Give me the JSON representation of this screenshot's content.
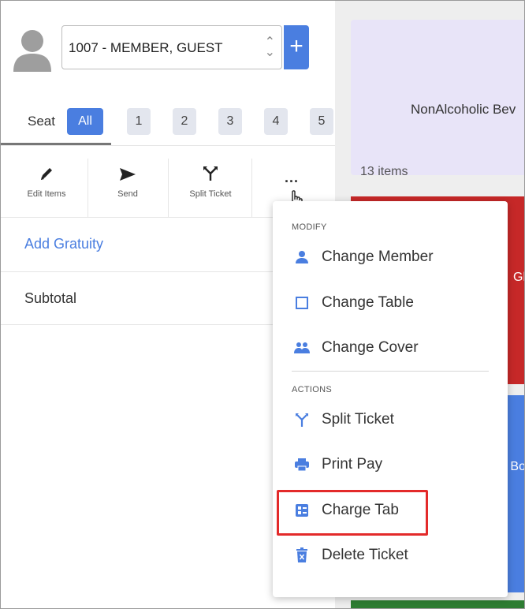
{
  "member_select": {
    "value": "1007 - MEMBER, GUEST"
  },
  "add_button": {
    "label": "+"
  },
  "seat": {
    "label": "Seat",
    "tabs": [
      "All",
      "1",
      "2",
      "3",
      "4",
      "5"
    ],
    "selected": "All"
  },
  "toolbar": {
    "edit_items": "Edit Items",
    "send": "Send",
    "split_ticket": "Split Ticket",
    "more": "..."
  },
  "ticket": {
    "add_gratuity": "Add Gratuity",
    "subtotal": "Subtotal"
  },
  "menu": {
    "modify_header": "MODIFY",
    "change_member": "Change Member",
    "change_table": "Change Table",
    "change_cover": "Change Cover",
    "actions_header": "ACTIONS",
    "split_ticket": "Split Ticket",
    "print_pay": "Print Pay",
    "charge_tab": "Charge Tab",
    "delete_ticket": "Delete Ticket"
  },
  "categories": {
    "nonalcoholic": {
      "name": "NonAlcoholic Bev",
      "count": "13 items"
    },
    "red_tile_label": "Gl",
    "blue_tile_label": "Bo"
  },
  "colors": {
    "accent": "#4a7ee0",
    "highlight": "#e32a2a",
    "tile_purple": "#e8e4f8",
    "tile_red": "#c62828",
    "tile_blue": "#4a7ee0"
  }
}
